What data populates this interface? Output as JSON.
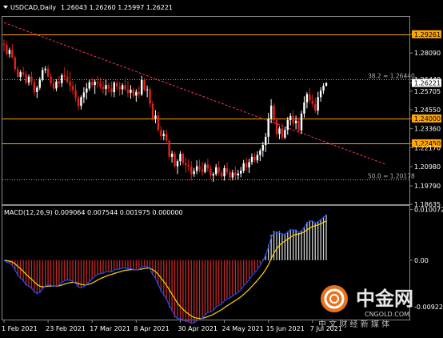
{
  "chart_data": [
    {
      "type": "candlestick",
      "title": "USDCAD,Daily",
      "ohlc_text": "1.26043 1.26260 1.25997 1.26221",
      "y_ticks": [
        "1.29261",
        "1.28090",
        "1.26440",
        "1.26221",
        "1.25705",
        "1.24550",
        "1.24000",
        "1.23360",
        "1.22450",
        "1.22170",
        "1.20980",
        "1.19790",
        "1.18635"
      ],
      "ylim": [
        1.1864,
        1.3035
      ],
      "x_ticks": [
        "1 Feb 2021",
        "23 Feb 2021",
        "17 Mar 2021",
        "8 Apr 2021",
        "30 Apr 2021",
        "24 May 2021",
        "15 Jun 2021",
        "7 Jul 2021"
      ],
      "horizontal_levels": [
        {
          "value": 1.29261,
          "color": "#ffa500",
          "label": "1.29261",
          "highlight": true
        },
        {
          "value": 1.24,
          "color": "#ffa500",
          "label": "1.24000",
          "highlight": true
        },
        {
          "value": 1.2245,
          "color": "#ffa500",
          "label": "1.22450",
          "highlight": true
        },
        {
          "value": 1.2644,
          "color": "#aaaaaa",
          "label": "38.2 = 1.26440",
          "dashed": true
        },
        {
          "value": 1.20178,
          "color": "#aaaaaa",
          "label": "50.0 = 1.20178",
          "dashed": true
        }
      ],
      "trendline": {
        "start": [
          0,
          1.2999
        ],
        "end": [
          127,
          1.2113
        ],
        "color": "#ff3355"
      },
      "current_price": "1.26221",
      "candles": [
        [
          1.2866,
          1.2893,
          1.2818,
          1.286
        ],
        [
          1.286,
          1.288,
          1.2795,
          1.2803
        ],
        [
          1.2803,
          1.2843,
          1.2781,
          1.2828
        ],
        [
          1.2828,
          1.2863,
          1.2773,
          1.2781
        ],
        [
          1.2781,
          1.2792,
          1.2692,
          1.2708
        ],
        [
          1.2708,
          1.2725,
          1.2652,
          1.266
        ],
        [
          1.266,
          1.2703,
          1.2634,
          1.2689
        ],
        [
          1.2689,
          1.2723,
          1.2661,
          1.2675
        ],
        [
          1.2675,
          1.2698,
          1.2612,
          1.2624
        ],
        [
          1.2624,
          1.2676,
          1.2606,
          1.2661
        ],
        [
          1.2661,
          1.2692,
          1.2608,
          1.2628
        ],
        [
          1.2628,
          1.2641,
          1.2542,
          1.2565
        ],
        [
          1.2565,
          1.2604,
          1.2527,
          1.2592
        ],
        [
          1.2592,
          1.2658,
          1.2578,
          1.2642
        ],
        [
          1.2642,
          1.272,
          1.263,
          1.2702
        ],
        [
          1.2702,
          1.2727,
          1.2683,
          1.2711
        ],
        [
          1.2711,
          1.2734,
          1.2654,
          1.2663
        ],
        [
          1.2663,
          1.2681,
          1.2603,
          1.262
        ],
        [
          1.262,
          1.2644,
          1.2571,
          1.2587
        ],
        [
          1.2587,
          1.2645,
          1.2569,
          1.2631
        ],
        [
          1.2631,
          1.2665,
          1.2596,
          1.262
        ],
        [
          1.262,
          1.2683,
          1.2596,
          1.267
        ],
        [
          1.267,
          1.2721,
          1.2639,
          1.2661
        ],
        [
          1.2661,
          1.2702,
          1.2618,
          1.2629
        ],
        [
          1.2629,
          1.2693,
          1.2566,
          1.2605
        ],
        [
          1.2605,
          1.2634,
          1.255,
          1.2577
        ],
        [
          1.2577,
          1.2615,
          1.2506,
          1.253
        ],
        [
          1.253,
          1.254,
          1.245,
          1.2479
        ],
        [
          1.2479,
          1.2544,
          1.2456,
          1.2533
        ],
        [
          1.2533,
          1.2595,
          1.2495,
          1.2562
        ],
        [
          1.2562,
          1.2622,
          1.2518,
          1.2587
        ],
        [
          1.2587,
          1.2643,
          1.2573,
          1.2627
        ],
        [
          1.2627,
          1.2655,
          1.2593,
          1.2609
        ],
        [
          1.2609,
          1.2644,
          1.2553,
          1.2629
        ],
        [
          1.2629,
          1.2664,
          1.2589,
          1.262
        ],
        [
          1.262,
          1.2656,
          1.2584,
          1.2598
        ],
        [
          1.2598,
          1.2636,
          1.2555,
          1.2584
        ],
        [
          1.2584,
          1.2644,
          1.2543,
          1.2609
        ],
        [
          1.2609,
          1.2623,
          1.2561,
          1.2587
        ],
        [
          1.2587,
          1.2631,
          1.2536,
          1.2564
        ],
        [
          1.2564,
          1.2634,
          1.2533,
          1.2623
        ],
        [
          1.2623,
          1.2638,
          1.2575,
          1.2599
        ],
        [
          1.2599,
          1.263,
          1.254,
          1.2582
        ],
        [
          1.2582,
          1.2621,
          1.2549,
          1.2608
        ],
        [
          1.2608,
          1.2654,
          1.2572,
          1.2581
        ],
        [
          1.2581,
          1.2634,
          1.2532,
          1.256
        ],
        [
          1.256,
          1.2608,
          1.2523,
          1.258
        ],
        [
          1.258,
          1.2592,
          1.2528,
          1.2542
        ],
        [
          1.2542,
          1.2583,
          1.2504,
          1.2566
        ],
        [
          1.2566,
          1.2602,
          1.2527,
          1.255
        ],
        [
          1.255,
          1.2666,
          1.2539,
          1.2641
        ],
        [
          1.2641,
          1.2652,
          1.2566,
          1.2578
        ],
        [
          1.2578,
          1.2606,
          1.2532,
          1.2581
        ],
        [
          1.2581,
          1.2597,
          1.2469,
          1.2491
        ],
        [
          1.2491,
          1.251,
          1.2388,
          1.24
        ],
        [
          1.24,
          1.2452,
          1.237,
          1.2418
        ],
        [
          1.2418,
          1.2442,
          1.2316,
          1.2327
        ],
        [
          1.2327,
          1.2355,
          1.2263,
          1.229
        ],
        [
          1.229,
          1.2326,
          1.2263,
          1.2303
        ],
        [
          1.2303,
          1.2331,
          1.225,
          1.2262
        ],
        [
          1.2262,
          1.2268,
          1.2144,
          1.216
        ],
        [
          1.216,
          1.2198,
          1.2124,
          1.218
        ],
        [
          1.218,
          1.2193,
          1.2093,
          1.2101
        ],
        [
          1.2101,
          1.2145,
          1.2052,
          1.2133
        ],
        [
          1.2133,
          1.2196,
          1.2107,
          1.2179
        ],
        [
          1.2179,
          1.2187,
          1.2107,
          1.2121
        ],
        [
          1.2121,
          1.2156,
          1.2062,
          1.2108
        ],
        [
          1.2108,
          1.2144,
          1.207,
          1.2099
        ],
        [
          1.2099,
          1.2135,
          1.2011,
          1.2053
        ],
        [
          1.2053,
          1.2091,
          1.2035,
          1.2071
        ],
        [
          1.2071,
          1.2138,
          1.2052,
          1.2102
        ],
        [
          1.2102,
          1.2143,
          1.2062,
          1.2081
        ],
        [
          1.2081,
          1.213,
          1.2041,
          1.2066
        ],
        [
          1.2066,
          1.2125,
          1.2057,
          1.2112
        ],
        [
          1.2112,
          1.2148,
          1.2067,
          1.2088
        ],
        [
          1.2088,
          1.2108,
          1.2022,
          1.2044
        ],
        [
          1.2044,
          1.2064,
          1.2004,
          1.2053
        ],
        [
          1.2053,
          1.2115,
          1.204,
          1.2095
        ],
        [
          1.2095,
          1.2135,
          1.2042,
          1.2061
        ],
        [
          1.2061,
          1.2078,
          1.2016,
          1.2038
        ],
        [
          1.2038,
          1.2108,
          1.2012,
          1.209
        ],
        [
          1.209,
          1.2125,
          1.2049,
          1.2065
        ],
        [
          1.2065,
          1.2082,
          1.2012,
          1.2031
        ],
        [
          1.2031,
          1.208,
          1.2013,
          1.2062
        ],
        [
          1.2062,
          1.21,
          1.2017,
          1.2044
        ],
        [
          1.2044,
          1.2079,
          1.2018,
          1.2056
        ],
        [
          1.2056,
          1.2097,
          1.2032,
          1.2074
        ],
        [
          1.2074,
          1.2141,
          1.2059,
          1.212
        ],
        [
          1.212,
          1.2155,
          1.2073,
          1.2094
        ],
        [
          1.2094,
          1.2148,
          1.2059,
          1.2127
        ],
        [
          1.2127,
          1.2181,
          1.211,
          1.216
        ],
        [
          1.216,
          1.2185,
          1.2126,
          1.2138
        ],
        [
          1.2138,
          1.2195,
          1.212,
          1.2172
        ],
        [
          1.2172,
          1.2212,
          1.2134,
          1.2199
        ],
        [
          1.2199,
          1.2254,
          1.216,
          1.2234
        ],
        [
          1.2234,
          1.231,
          1.219,
          1.2285
        ],
        [
          1.2285,
          1.2435,
          1.224,
          1.24
        ],
        [
          1.24,
          1.252,
          1.2371,
          1.248
        ],
        [
          1.248,
          1.2495,
          1.237,
          1.2389
        ],
        [
          1.2389,
          1.2405,
          1.2285,
          1.2303
        ],
        [
          1.2303,
          1.2351,
          1.227,
          1.2337
        ],
        [
          1.2337,
          1.2367,
          1.2264,
          1.228
        ],
        [
          1.228,
          1.2347,
          1.227,
          1.2328
        ],
        [
          1.2328,
          1.2409,
          1.2298,
          1.239
        ],
        [
          1.239,
          1.2434,
          1.2357,
          1.2416
        ],
        [
          1.2416,
          1.2452,
          1.235,
          1.237
        ],
        [
          1.237,
          1.2418,
          1.2332,
          1.2386
        ],
        [
          1.2386,
          1.2408,
          1.2308,
          1.2325
        ],
        [
          1.2325,
          1.2448,
          1.2303,
          1.243
        ],
        [
          1.243,
          1.2538,
          1.2405,
          1.25
        ],
        [
          1.25,
          1.2564,
          1.2463,
          1.2552
        ],
        [
          1.2552,
          1.2592,
          1.2495,
          1.2511
        ],
        [
          1.2511,
          1.255,
          1.247,
          1.249
        ],
        [
          1.249,
          1.2529,
          1.2433,
          1.2449
        ],
        [
          1.2449,
          1.2567,
          1.2422,
          1.2533
        ],
        [
          1.2533,
          1.2595,
          1.2505,
          1.2574
        ],
        [
          1.2574,
          1.262,
          1.2553,
          1.2604
        ],
        [
          1.2604,
          1.2626,
          1.26,
          1.2622
        ]
      ],
      "last_closes_note": ""
    },
    {
      "type": "macd",
      "title": "MACD(12,26,9) 0.009064 0.007544 0.001975 0.000000",
      "y_ticks": [
        "0.010072",
        "0.00",
        "-0.009224"
      ],
      "ylim": [
        -0.0118,
        0.0108
      ]
    }
  ],
  "watermark": {
    "brand": "中金网",
    "url": "CNGOLD.COM",
    "tagline": "中 文 财 经 新 媒 体"
  }
}
